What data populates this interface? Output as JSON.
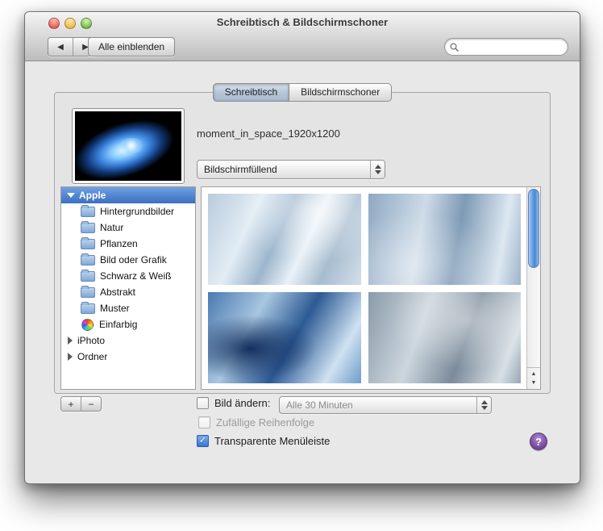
{
  "window_title": "Schreibtisch & Bildschirmschoner",
  "toolbar": {
    "show_all": "Alle einblenden",
    "search_placeholder": ""
  },
  "tabs": {
    "desktop": "Schreibtisch",
    "screensaver": "Bildschirmschoner"
  },
  "preview": {
    "filename": "moment_in_space_1920x1200",
    "fill_mode": "Bildschirmfüllend"
  },
  "sidebar": {
    "apple": "Apple",
    "apple_children": [
      "Hintergrundbilder",
      "Natur",
      "Pflanzen",
      "Bild oder Grafik",
      "Schwarz & Weiß",
      "Abstrakt",
      "Muster",
      "Einfarbig"
    ],
    "iphoto": "iPhoto",
    "ordner": "Ordner"
  },
  "footer": {
    "add": "+",
    "remove": "−",
    "change_picture": "Bild ändern:",
    "interval": "Alle 30 Minuten",
    "random_order": "Zufällige Reihenfolge",
    "translucent_menubar": "Transparente Menüleiste",
    "help": "?"
  },
  "icons": {
    "search": "magnifier",
    "sidebar_folders": "blue-folder",
    "einfarbig": "color-wheel",
    "help": "question-mark"
  },
  "colors": {
    "selection_blue_top": "#6ea0e2",
    "selection_blue_bottom": "#3c6fc0",
    "checkbox_accent": "#3875d7",
    "scrollbar_blue": "#5f98dd"
  }
}
